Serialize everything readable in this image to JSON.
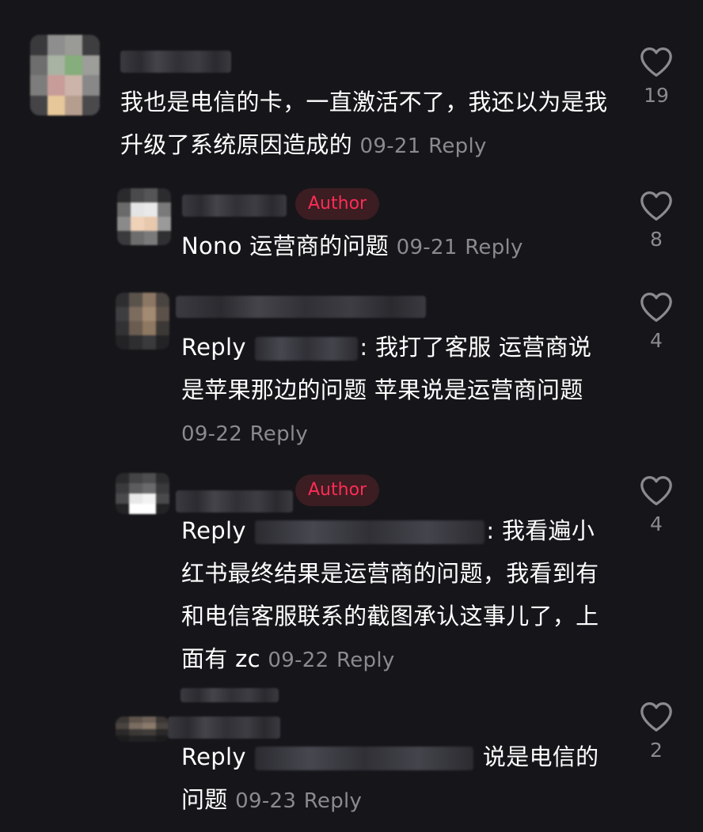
{
  "comments": [
    {
      "level": "top",
      "text": "我也是电信的卡，一直激活不了，我还以为是我升级了系统原因造成的",
      "date": "09-21",
      "reply_label": "Reply",
      "likes": "19"
    },
    {
      "level": "reply",
      "author_badge": "Author",
      "text": "Nono 运营商的问题",
      "date": "09-21",
      "reply_label": "Reply",
      "likes": "8"
    },
    {
      "level": "reply",
      "prefix": "Reply",
      "text": ": 我打了客服 运营商说是苹果那边的问题 苹果说是运营商问题",
      "date": "09-22",
      "reply_label": "Reply",
      "likes": "4"
    },
    {
      "level": "reply",
      "author_badge": "Author",
      "prefix": "Reply",
      "text": ": 我看遍小红书最终结果是运营商的问题，我看到有和电信客服联系的截图承认这事儿了，上面有 zc",
      "date": "09-22",
      "reply_label": "Reply",
      "likes": "4"
    },
    {
      "level": "reply",
      "prefix": "Reply",
      "text": "说是电信的问题",
      "date": "09-23",
      "reply_label": "Reply",
      "likes": "2"
    }
  ],
  "colors": {
    "background": "#16161a",
    "text": "#ffffff",
    "muted": "#8a8a8f",
    "author_badge_text": "#fe2c55",
    "author_badge_bg": "#3b1d22"
  },
  "icons": {
    "like": "heart-outline-icon"
  }
}
